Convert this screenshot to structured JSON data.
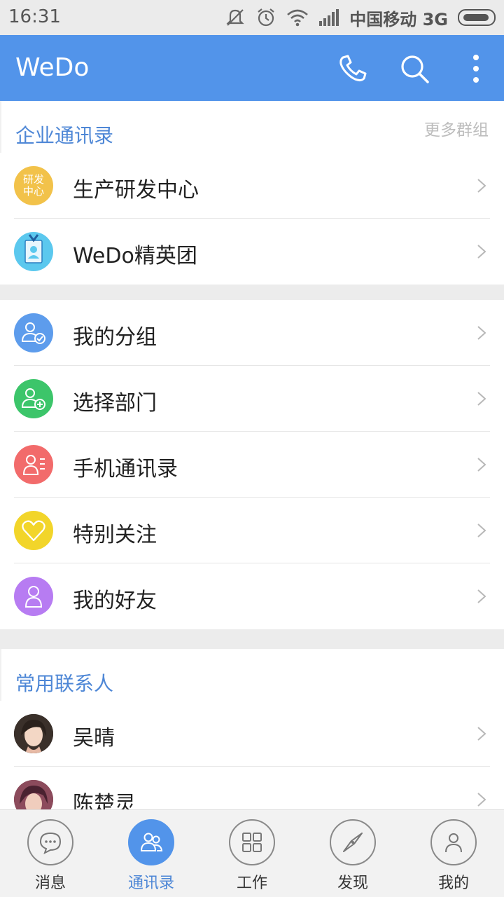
{
  "status_bar": {
    "time": "16:31",
    "carrier": "中国移动 3G"
  },
  "app_bar": {
    "title": "WeDo",
    "icons": [
      "phone-icon",
      "search-icon",
      "more-vert-icon"
    ]
  },
  "enterprise": {
    "title": "企业通讯录",
    "more": "更多群组",
    "items": [
      {
        "label": "生产研发中心",
        "badge": "研发\n中心",
        "color": "#f2c24a"
      },
      {
        "label": "WeDo精英团",
        "color": "#5bc8ee"
      }
    ]
  },
  "menu": {
    "items": [
      {
        "label": "我的分组",
        "icon": "group-check-icon",
        "color": "#5d9cec"
      },
      {
        "label": "选择部门",
        "icon": "group-add-icon",
        "color": "#3cc56a"
      },
      {
        "label": "手机通讯录",
        "icon": "contact-list-icon",
        "color": "#f26b6b"
      },
      {
        "label": "特别关注",
        "icon": "heart-icon",
        "color": "#f2d52a"
      },
      {
        "label": "我的好友",
        "icon": "person-icon",
        "color": "#b77cf2"
      }
    ]
  },
  "frequent": {
    "title": "常用联系人",
    "contacts": [
      {
        "name": "吴晴"
      },
      {
        "name": "陈楚灵"
      }
    ]
  },
  "bottom_nav": {
    "items": [
      {
        "label": "消息",
        "icon": "chat-bubble-icon"
      },
      {
        "label": "通讯录",
        "icon": "contacts-icon",
        "active": true
      },
      {
        "label": "工作",
        "icon": "grid-icon"
      },
      {
        "label": "发现",
        "icon": "compass-icon"
      },
      {
        "label": "我的",
        "icon": "profile-icon"
      }
    ]
  },
  "colors": {
    "primary": "#5294ea",
    "section_title": "#4e87d6"
  }
}
